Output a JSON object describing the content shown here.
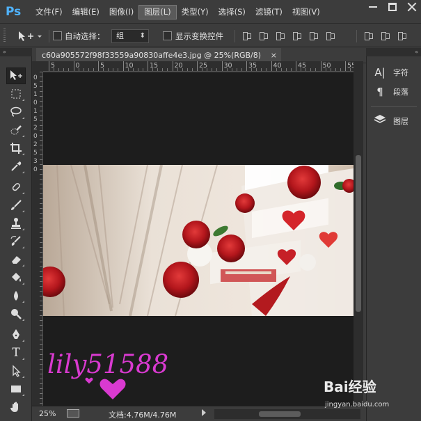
{
  "app": {
    "logo": "Ps"
  },
  "menu": [
    {
      "label": "文件(F)",
      "active": false
    },
    {
      "label": "编辑(E)",
      "active": false
    },
    {
      "label": "图像(I)",
      "active": false
    },
    {
      "label": "图层(L)",
      "active": true
    },
    {
      "label": "类型(Y)",
      "active": false
    },
    {
      "label": "选择(S)",
      "active": false
    },
    {
      "label": "滤镜(T)",
      "active": false
    },
    {
      "label": "视图(V)",
      "active": false
    }
  ],
  "options": {
    "auto_select_label": "自动选择：",
    "auto_select_value": "组",
    "show_transform_label": "显示变换控件"
  },
  "document": {
    "tab_title": "c60a905572f98f33559a90830affe4e3.jpg @ 25%(RGB/8)",
    "close": "×"
  },
  "ruler_h": [
    "5",
    "0",
    "5",
    "10",
    "15",
    "20",
    "25",
    "30",
    "35",
    "40",
    "45",
    "50",
    "55",
    "60"
  ],
  "ruler_v": [
    "0",
    "5",
    "1",
    "0",
    "1",
    "5",
    "2",
    "0",
    "2",
    "5",
    "3",
    "0"
  ],
  "canvas": {
    "watermark": "lily51588"
  },
  "status": {
    "zoom": "25%",
    "doc_info": "文档:4.76M/4.76M"
  },
  "panels": [
    {
      "label": "字符",
      "icon": "character-icon"
    },
    {
      "label": "段落",
      "icon": "paragraph-icon"
    },
    {
      "label": "图层",
      "icon": "layers-icon"
    }
  ],
  "footer": {
    "brand": "Bai经验",
    "url": "jingyan.baidu.com"
  },
  "colors": {
    "accent": "#4fb3ff",
    "watermark": "#d93ad0",
    "canvas": "#1d1d1d"
  }
}
